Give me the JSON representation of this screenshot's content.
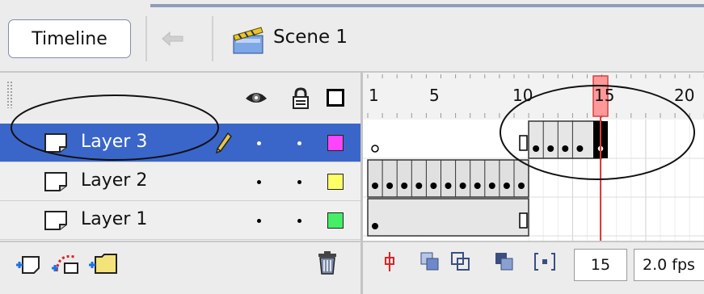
{
  "header": {
    "timeline_label": "Timeline",
    "scene_label": "Scene 1"
  },
  "layer_header": {
    "icons": [
      "eye-icon",
      "lock-icon",
      "outline-icon"
    ]
  },
  "layers": [
    {
      "name": "Layer 3",
      "selected": true,
      "color": "#ff44ff",
      "editing": true
    },
    {
      "name": "Layer 2",
      "selected": false,
      "color": "#ffff66",
      "editing": false
    },
    {
      "name": "Layer 1",
      "selected": false,
      "color": "#44ee66",
      "editing": false
    }
  ],
  "ruler": {
    "labels": [
      "1",
      "5",
      "10",
      "15",
      "20"
    ]
  },
  "playhead_frame": 15,
  "status": {
    "current_frame": "15",
    "fps": "2.0 fps"
  },
  "colors": {
    "selection": "#3a66c9",
    "playhead": "#e03a3a"
  }
}
